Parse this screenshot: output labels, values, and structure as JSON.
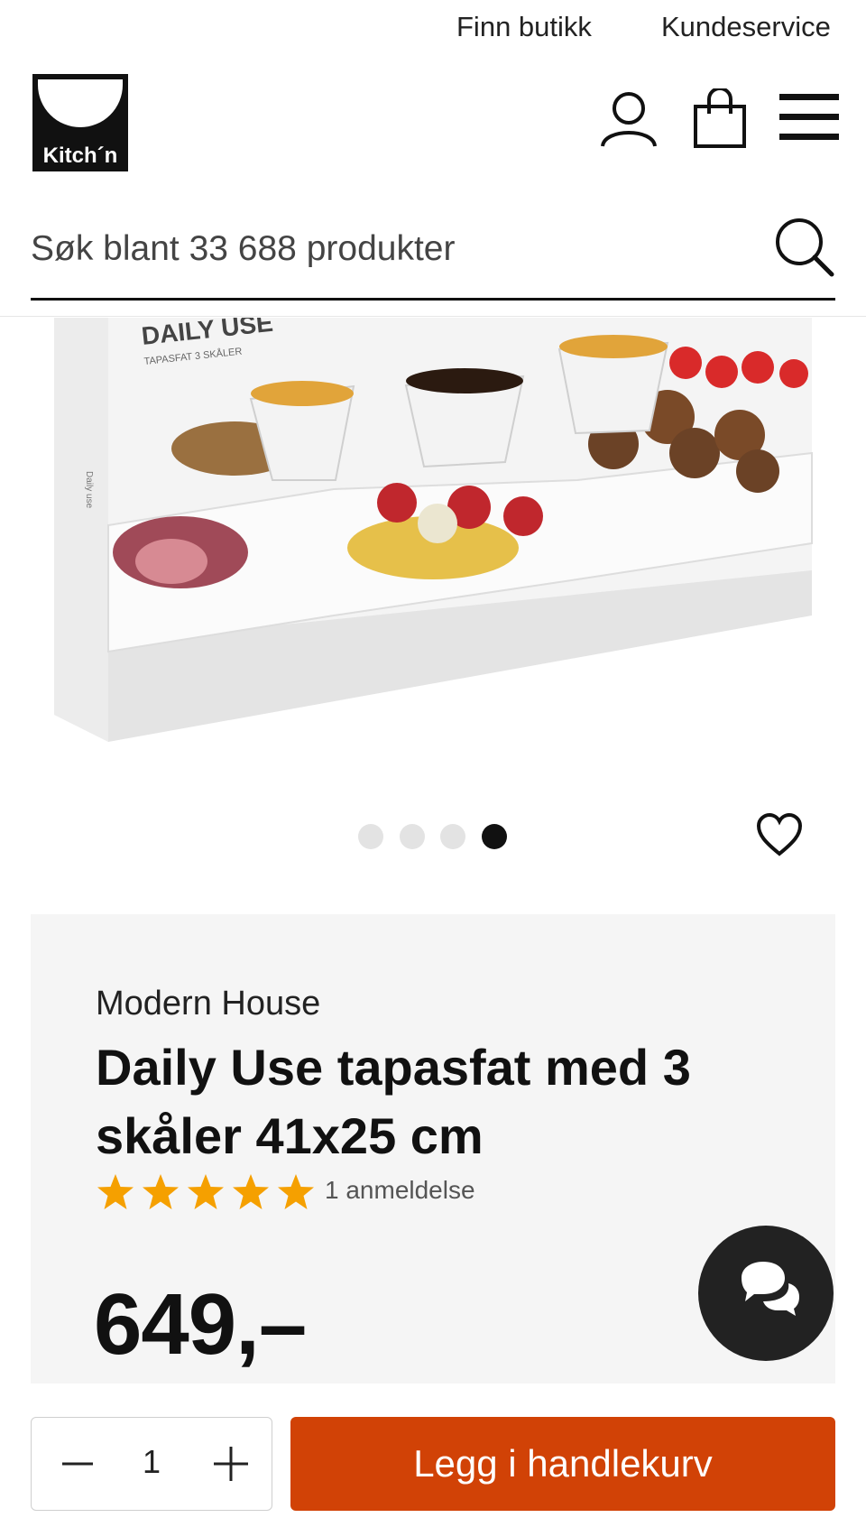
{
  "topbar": {
    "find_store": "Finn butikk",
    "customer_service": "Kundeservice"
  },
  "header": {
    "logo_text": "Kitch´n",
    "icons": [
      "user-icon",
      "shopping-bag-icon",
      "menu-icon"
    ]
  },
  "search": {
    "placeholder": "Søk blant 33 688 produkter"
  },
  "product_image": {
    "box_title": "DAILY USE",
    "box_subtitle": "TAPASFAT 3 SKÅLER",
    "box_side": "Daily use"
  },
  "carousel": {
    "total": 4,
    "active_index": 3
  },
  "product": {
    "brand": "Modern House",
    "title": "Daily Use tapasfat med 3 skåler 41x25 cm",
    "rating": 5,
    "rating_max": 5,
    "reviews": "1 anmeldelse",
    "price": "649,–"
  },
  "cart": {
    "quantity": "1",
    "add_label": "Legg i handlekurv"
  },
  "colors": {
    "accent": "#d14206",
    "star": "#f5a000",
    "panel": "#f5f5f5",
    "text": "#111111"
  }
}
